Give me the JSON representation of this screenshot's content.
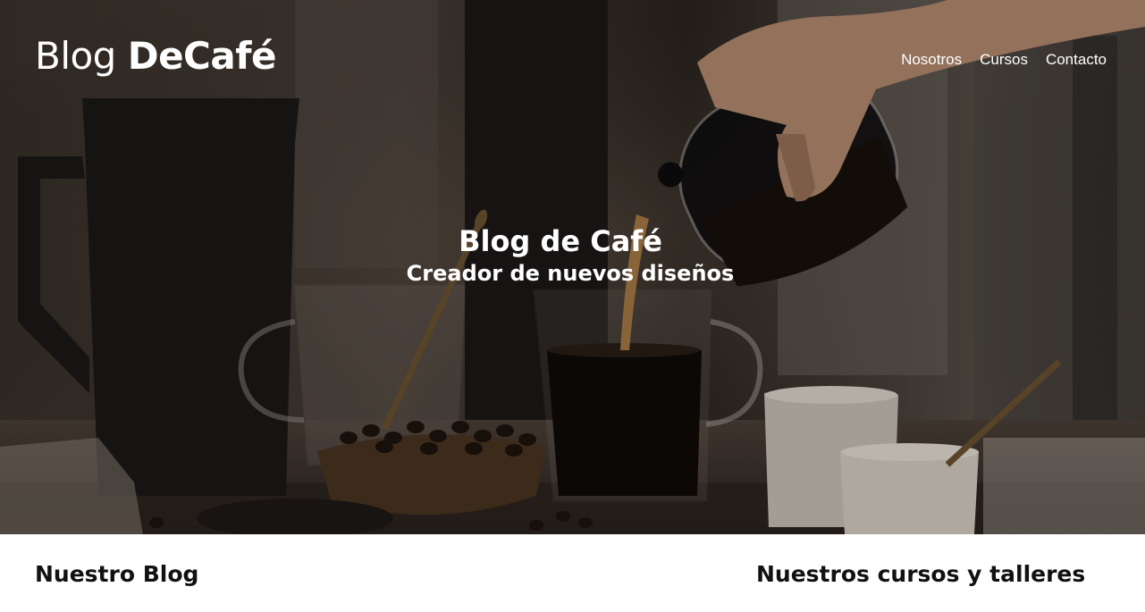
{
  "header": {
    "logo_light": "Blog ",
    "logo_bold": "DeCafé",
    "nav": [
      {
        "label": "Nosotros"
      },
      {
        "label": "Cursos"
      },
      {
        "label": "Contacto"
      }
    ]
  },
  "hero": {
    "title": "Blog de Café",
    "subtitle": "Creador de nuevos diseños"
  },
  "sections": {
    "blog_heading": "Nuestro Blog",
    "courses_heading": "Nuestros cursos y talleres"
  },
  "colors": {
    "text_dark": "#111111",
    "hero_text": "#ffffff"
  }
}
